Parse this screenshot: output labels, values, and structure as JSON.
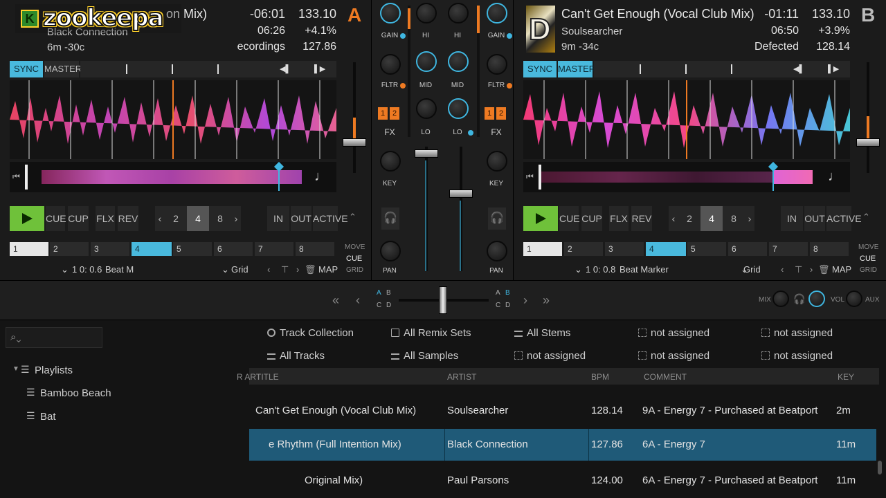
{
  "logo": {
    "badge": "K",
    "text": "zookeepa"
  },
  "deck_a": {
    "letter": "A",
    "title": "on Mix)",
    "artist": "Black Connection",
    "length": "6m -30c",
    "remaining": "-06:01",
    "elapsed": "06:26",
    "label": "ecordings",
    "tempo": "133.10",
    "pitch": "+4.1%",
    "bpm": "127.86",
    "sync": "SYNC",
    "master": "MASTER",
    "transport": {
      "cue": "CUE",
      "cup": "CUP",
      "flx": "FLX",
      "rev": "REV"
    },
    "loop_sizes": [
      "2",
      "4",
      "8"
    ],
    "loop_selected": "4",
    "loop_controls": {
      "in": "IN",
      "out": "OUT",
      "active": "ACTIVE"
    },
    "cue_slots": [
      "1",
      "2",
      "3",
      "4",
      "5",
      "6",
      "7",
      "8"
    ],
    "move": {
      "move": "MOVE",
      "cue": "CUE",
      "grid": "GRID"
    },
    "cue_position": "1 0: 0.6",
    "cue_type": "Beat M",
    "grid": "Grid",
    "map": "MAP"
  },
  "deck_b": {
    "letter": "B",
    "title": "Can't Get Enough (Vocal Club Mix)",
    "artist": "Soulsearcher",
    "length": "9m -34c",
    "remaining": "-01:11",
    "elapsed": "06:50",
    "label": "Defected",
    "tempo": "133.10",
    "pitch": "+3.9%",
    "bpm": "128.14",
    "sync": "SYNC",
    "master": "MASTER",
    "art_letter": "D",
    "transport": {
      "cue": "CUE",
      "cup": "CUP",
      "flx": "FLX",
      "rev": "REV"
    },
    "loop_sizes": [
      "2",
      "4",
      "8"
    ],
    "loop_selected": "4",
    "loop_controls": {
      "in": "IN",
      "out": "OUT",
      "active": "ACTIVE"
    },
    "cue_slots": [
      "1",
      "2",
      "3",
      "4",
      "5",
      "6",
      "7",
      "8"
    ],
    "move": {
      "move": "MOVE",
      "cue": "CUE",
      "grid": "GRID"
    },
    "cue_position": "1 0: 0.8",
    "cue_type": "Beat Marker",
    "grid": "Grid",
    "map": "MAP"
  },
  "mixer": {
    "gain": "GAIN",
    "hi": "HI",
    "mid": "MID",
    "lo": "LO",
    "fltr": "FLTR",
    "fx": "FX",
    "key": "KEY",
    "pan": "PAN",
    "fx_1": "1",
    "fx_2": "2"
  },
  "crossfader": {
    "a": "A",
    "b": "B",
    "c": "C",
    "d": "D",
    "mix": "MIX",
    "vol": "VOL",
    "aux": "AUX"
  },
  "favorites": {
    "row1": [
      "Track Collection",
      "All Remix Sets",
      "All Stems",
      "not assigned",
      "not assigned"
    ],
    "row2": [
      "All Tracks",
      "All Samples",
      "not assigned",
      "not assigned",
      "not assigned"
    ]
  },
  "sidebar": {
    "header": "Playlists",
    "items": [
      "Bamboo Beach",
      "Bat"
    ]
  },
  "table": {
    "columns": {
      "art": "R ART",
      "title": "TITLE",
      "artist": "ARTIST",
      "bpm": "BPM",
      "comment": "COMMENT",
      "key": "KEY"
    },
    "rows": [
      {
        "title": "Can't Get Enough (Vocal Club Mix)",
        "artist": "Soulsearcher",
        "bpm": "128.14",
        "comment": "9A - Energy 7 - Purchased at Beatport",
        "key": "2m"
      },
      {
        "title": "e Rhythm (Full Intention Mix)",
        "artist": "Black Connection",
        "bpm": "127.86",
        "comment": "6A - Energy 7",
        "key": "11m"
      },
      {
        "title": "Original Mix)",
        "artist": "Paul Parsons",
        "bpm": "124.00",
        "comment": "6A - Energy 7 - Purchased at Beatport",
        "key": "11m"
      }
    ],
    "selected_row": 1
  },
  "colors": {
    "accent": "#49b9dd",
    "orange": "#ee7a22",
    "play": "#6fc13a",
    "selected_row": "#1f5a78"
  }
}
